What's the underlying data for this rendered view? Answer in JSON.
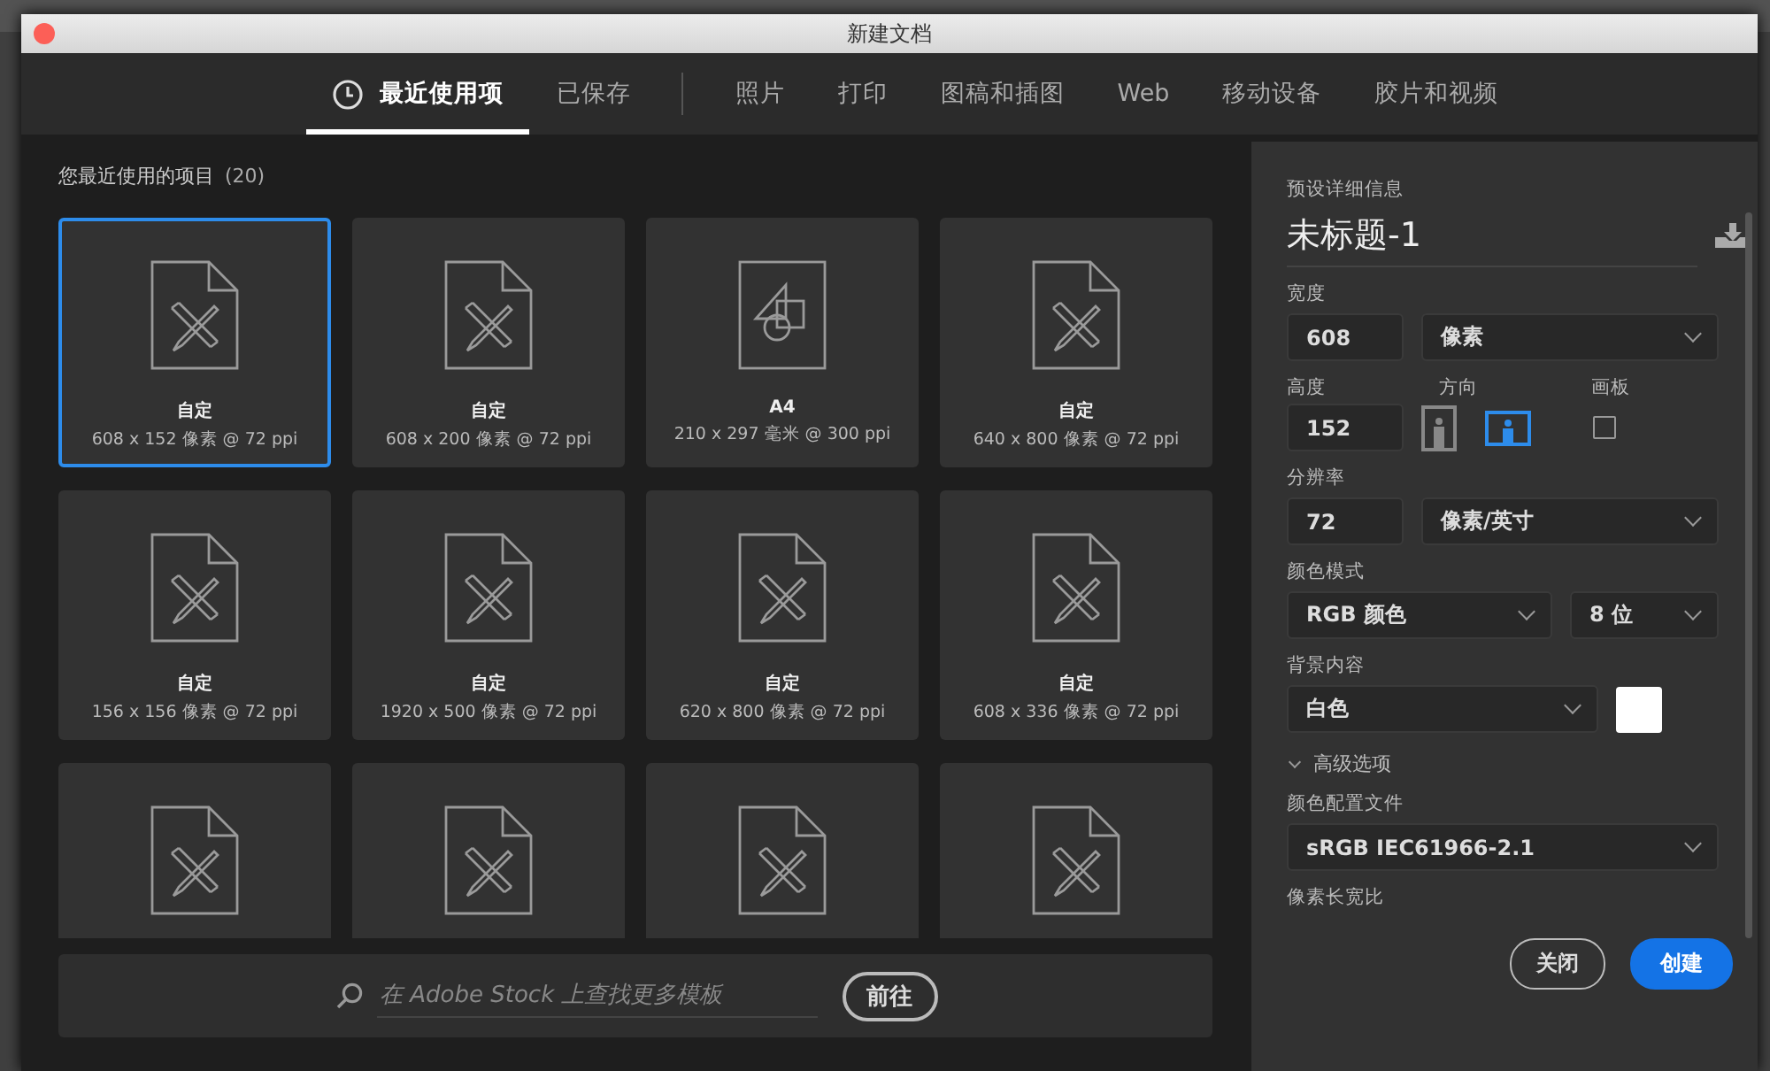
{
  "window": {
    "title": "新建文档"
  },
  "tabs": [
    {
      "label": "最近使用项",
      "kind": "recent",
      "selected": true
    },
    {
      "label": "已保存",
      "kind": "saved",
      "selected": false
    },
    {
      "label": "照片",
      "kind": "category",
      "selected": false
    },
    {
      "label": "打印",
      "kind": "category",
      "selected": false
    },
    {
      "label": "图稿和插图",
      "kind": "category",
      "selected": false
    },
    {
      "label": "Web",
      "kind": "category",
      "selected": false
    },
    {
      "label": "移动设备",
      "kind": "category",
      "selected": false
    },
    {
      "label": "胶片和视频",
      "kind": "category",
      "selected": false
    }
  ],
  "recent": {
    "title": "您最近使用的项目",
    "count": "(20)",
    "items": [
      {
        "name": "自定",
        "size": "608 x 152 像素 @ 72 ppi",
        "kind": "custom",
        "selected": true
      },
      {
        "name": "自定",
        "size": "608 x 200 像素 @ 72 ppi",
        "kind": "custom",
        "selected": false
      },
      {
        "name": "A4",
        "size": "210 x 297 毫米 @ 300 ppi",
        "kind": "paper",
        "selected": false
      },
      {
        "name": "自定",
        "size": "640 x 800 像素 @ 72 ppi",
        "kind": "custom",
        "selected": false
      },
      {
        "name": "自定",
        "size": "156 x 156 像素 @ 72 ppi",
        "kind": "custom",
        "selected": false
      },
      {
        "name": "自定",
        "size": "1920 x 500 像素 @ 72 ppi",
        "kind": "custom",
        "selected": false
      },
      {
        "name": "自定",
        "size": "620 x 800 像素 @ 72 ppi",
        "kind": "custom",
        "selected": false
      },
      {
        "name": "自定",
        "size": "608 x 336 像素 @ 72 ppi",
        "kind": "custom",
        "selected": false
      },
      {
        "kind": "custom",
        "selected": false
      },
      {
        "kind": "custom",
        "selected": false
      },
      {
        "kind": "custom",
        "selected": false
      },
      {
        "kind": "custom",
        "selected": false
      }
    ]
  },
  "stock_search": {
    "placeholder": "在 Adobe Stock 上查找更多模板",
    "button": "前往"
  },
  "preset_details": {
    "heading": "预设详细信息",
    "document_name": "未标题-1",
    "width": {
      "label": "宽度",
      "value": "608",
      "unit": "像素"
    },
    "height": {
      "label": "高度",
      "value": "152"
    },
    "orientation": {
      "label": "方向",
      "options": [
        {
          "kind": "portrait",
          "selected": false
        },
        {
          "kind": "landscape",
          "selected": true
        }
      ]
    },
    "artboard": {
      "label": "画板",
      "checked": false
    },
    "resolution": {
      "label": "分辨率",
      "value": "72",
      "unit": "像素/英寸"
    },
    "color_mode": {
      "label": "颜色模式",
      "mode": "RGB 颜色",
      "depth": "8 位"
    },
    "background": {
      "label": "背景内容",
      "value": "白色",
      "color": "#ffffff"
    },
    "advanced": {
      "label": "高级选项",
      "expanded": true
    },
    "color_profile": {
      "label": "颜色配置文件",
      "value": "sRGB IEC61966-2.1"
    },
    "pixel_aspect": {
      "label": "像素长宽比"
    }
  },
  "buttons": [
    {
      "label": "关闭",
      "kind": "secondary"
    },
    {
      "label": "创建",
      "kind": "primary"
    }
  ]
}
